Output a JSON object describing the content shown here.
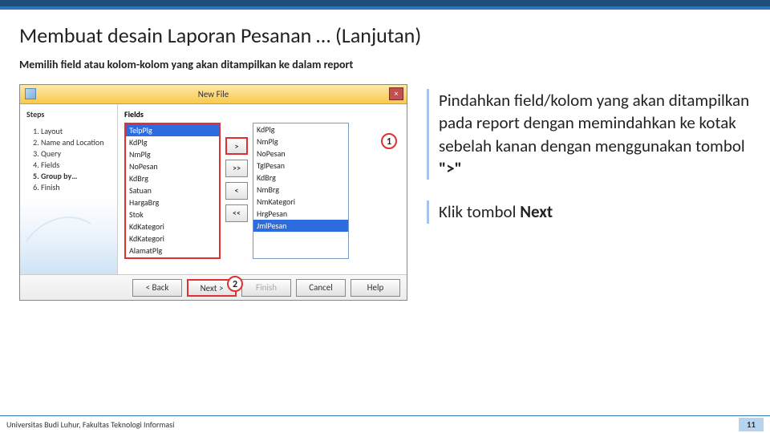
{
  "slide": {
    "title": "Membuat desain Laporan Pesanan … (Lanjutan)",
    "subtitle": "Memilih field atau kolom-kolom yang akan ditampilkan ke dalam report"
  },
  "dialog": {
    "title": "New File",
    "close": "×",
    "steps_header": "Steps",
    "steps": [
      "Layout",
      "Name and Location",
      "Query",
      "Fields",
      "Group by…",
      "Finish"
    ],
    "current_step_index": 4,
    "fields_header": "Fields",
    "available": [
      "TelpPlg",
      "KdPlg",
      "NmPlg",
      "NoPesan",
      "KdBrg",
      "Satuan",
      "HargaBrg",
      "Stok",
      "KdKategori",
      "KdKategori",
      "AlamatPlg"
    ],
    "selected": [
      "KdPlg",
      "NmPlg",
      "NoPesan",
      "TglPesan",
      "KdBrg",
      "NmBrg",
      "NmKategori",
      "HrgPesan",
      "JmlPesan"
    ],
    "selected_hl_index": 8,
    "move": {
      "add": ">",
      "addall": ">>",
      "remove": "<",
      "removeall": "<<"
    },
    "buttons": {
      "back": "< Back",
      "next": "Next >",
      "finish": "Finish",
      "cancel": "Cancel",
      "help": "Help"
    }
  },
  "markers": {
    "one": "1",
    "two": "2"
  },
  "instructions": {
    "block1_parts": [
      "Pindahkan field/kolom yang akan ditampilkan pada report dengan memindahkan ke kotak sebelah kanan dengan menggunakan tombol ",
      "\">\""
    ],
    "block2_parts": [
      "Klik tombol ",
      "Next"
    ]
  },
  "footer": {
    "org": "Universitas Budi Luhur, Fakultas Teknologi Informasi",
    "page": "11"
  }
}
